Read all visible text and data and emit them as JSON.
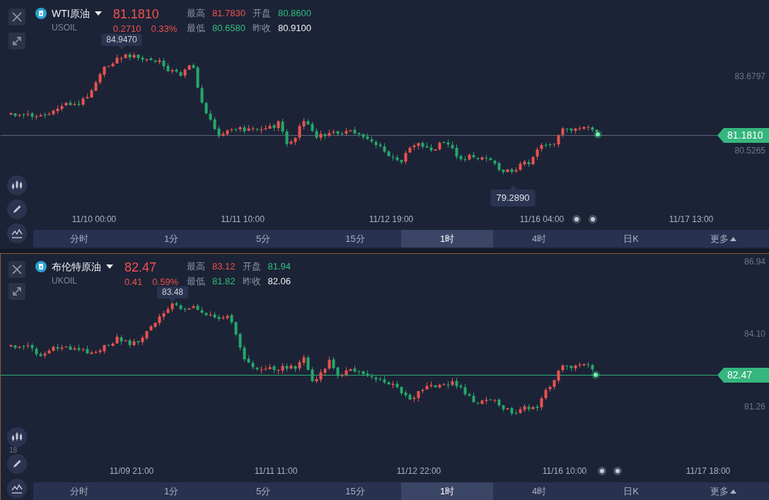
{
  "panels": [
    {
      "selected": false,
      "symbol": {
        "name": "WTI原油",
        "code": "USOIL"
      },
      "quote": {
        "price": "81.1810",
        "change": "0.2710",
        "change_pct": "0.33%",
        "rising": true
      },
      "stats": [
        {
          "label": "最高",
          "value": "81.7830",
          "color": "#f0514e"
        },
        {
          "label": "开盘",
          "value": "80.8600",
          "color": "#2fbf7d"
        },
        {
          "label": "最低",
          "value": "80.6580",
          "color": "#2fbf7d"
        },
        {
          "label": "昨收",
          "value": "80.9100",
          "color": "#eef0f4"
        }
      ],
      "chart": {
        "price_axis": [
          "83.6797",
          "80.5265"
        ],
        "time_axis": [
          "11/10 00:00",
          "11/11 10:00",
          "11/12 19:00",
          "11/16 04:00",
          "11/17 13:00"
        ],
        "current_price": "81.1810",
        "high_label": "84.9470",
        "low_label": "79.2890"
      },
      "tabs": [
        {
          "label": "分时",
          "selected": false,
          "kind": "interval"
        },
        {
          "label": "1分",
          "selected": false,
          "kind": "interval"
        },
        {
          "label": "5分",
          "selected": false,
          "kind": "interval"
        },
        {
          "label": "15分",
          "selected": false,
          "kind": "interval"
        },
        {
          "label": "1时",
          "selected": true,
          "kind": "interval"
        },
        {
          "label": "4时",
          "selected": false,
          "kind": "interval"
        },
        {
          "label": "日K",
          "selected": false,
          "kind": "interval"
        },
        {
          "label": "更多",
          "selected": false,
          "kind": "menu"
        }
      ]
    },
    {
      "selected": true,
      "symbol": {
        "name": "布伦特原油",
        "code": "UKOIL"
      },
      "quote": {
        "price": "82.47",
        "change": "0.41",
        "change_pct": "0.59%",
        "rising": true
      },
      "stats": [
        {
          "label": "最高",
          "value": "83.12",
          "color": "#f0514e"
        },
        {
          "label": "开盘",
          "value": "81.94",
          "color": "#2fbf7d"
        },
        {
          "label": "最低",
          "value": "81.82",
          "color": "#2fbf7d"
        },
        {
          "label": "昨收",
          "value": "82.06",
          "color": "#eef0f4"
        }
      ],
      "chart": {
        "price_axis": [
          "86.94",
          "84.10",
          "81.26"
        ],
        "axis_fragment": "18",
        "time_axis": [
          "11/09 21:00",
          "11/11 11:00",
          "11/12 22:00",
          "11/16 10:00",
          "11/17 18:00"
        ],
        "current_price": "82.47",
        "high_label": "83.48"
      },
      "tabs": [
        {
          "label": "分时",
          "selected": false,
          "kind": "interval"
        },
        {
          "label": "1分",
          "selected": false,
          "kind": "interval"
        },
        {
          "label": "5分",
          "selected": false,
          "kind": "interval"
        },
        {
          "label": "15分",
          "selected": false,
          "kind": "interval"
        },
        {
          "label": "1时",
          "selected": true,
          "kind": "interval"
        },
        {
          "label": "4时",
          "selected": false,
          "kind": "interval"
        },
        {
          "label": "日K",
          "selected": false,
          "kind": "interval"
        },
        {
          "label": "更多",
          "selected": false,
          "kind": "menu"
        }
      ]
    }
  ]
}
